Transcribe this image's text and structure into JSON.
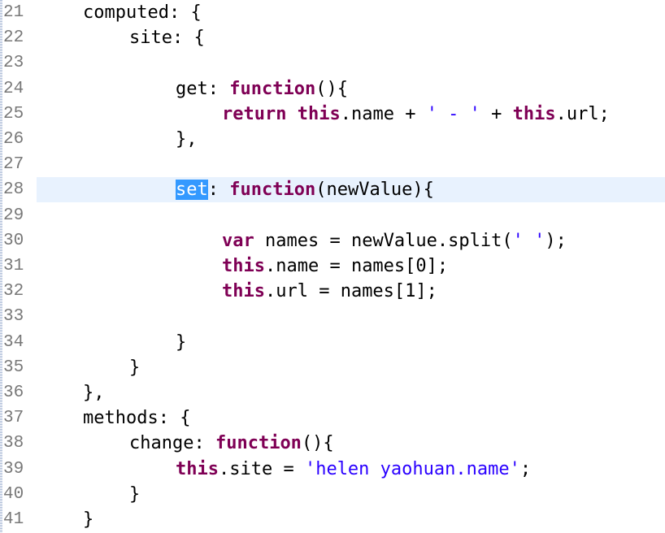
{
  "editor": {
    "lines": [
      {
        "num": "21",
        "indent": 1,
        "tokens": [
          {
            "t": "computed: {",
            "c": "plain"
          }
        ]
      },
      {
        "num": "22",
        "indent": 2,
        "tokens": [
          {
            "t": "site: {",
            "c": "plain"
          }
        ]
      },
      {
        "num": "23",
        "indent": 0,
        "tokens": []
      },
      {
        "num": "24",
        "indent": 3,
        "tokens": [
          {
            "t": "get: ",
            "c": "plain"
          },
          {
            "t": "function",
            "c": "kw"
          },
          {
            "t": "(){",
            "c": "plain"
          }
        ]
      },
      {
        "num": "25",
        "indent": 4,
        "tokens": [
          {
            "t": "return",
            "c": "kw"
          },
          {
            "t": " ",
            "c": "plain"
          },
          {
            "t": "this",
            "c": "kw"
          },
          {
            "t": ".name + ",
            "c": "plain"
          },
          {
            "t": "' - '",
            "c": "str"
          },
          {
            "t": " + ",
            "c": "plain"
          },
          {
            "t": "this",
            "c": "kw"
          },
          {
            "t": ".url;",
            "c": "plain"
          }
        ]
      },
      {
        "num": "26",
        "indent": 3,
        "tokens": [
          {
            "t": "},",
            "c": "plain"
          }
        ]
      },
      {
        "num": "27",
        "indent": 0,
        "tokens": []
      },
      {
        "num": "28",
        "indent": 3,
        "current": true,
        "tokens": [
          {
            "t": "set",
            "c": "sel"
          },
          {
            "t": ": ",
            "c": "plain"
          },
          {
            "t": "function",
            "c": "kw"
          },
          {
            "t": "(newValue){",
            "c": "plain"
          }
        ]
      },
      {
        "num": "29",
        "indent": 0,
        "tokens": []
      },
      {
        "num": "30",
        "indent": 4,
        "tokens": [
          {
            "t": "var",
            "c": "kw"
          },
          {
            "t": " names = newValue.split(",
            "c": "plain"
          },
          {
            "t": "' '",
            "c": "str"
          },
          {
            "t": ");",
            "c": "plain"
          }
        ]
      },
      {
        "num": "31",
        "indent": 4,
        "tokens": [
          {
            "t": "this",
            "c": "kw"
          },
          {
            "t": ".name = names[0];",
            "c": "plain"
          }
        ]
      },
      {
        "num": "32",
        "indent": 4,
        "tokens": [
          {
            "t": "this",
            "c": "kw"
          },
          {
            "t": ".url = names[1];",
            "c": "plain"
          }
        ]
      },
      {
        "num": "33",
        "indent": 0,
        "tokens": []
      },
      {
        "num": "34",
        "indent": 3,
        "tokens": [
          {
            "t": "}",
            "c": "plain"
          }
        ]
      },
      {
        "num": "35",
        "indent": 2,
        "tokens": [
          {
            "t": "}",
            "c": "plain"
          }
        ]
      },
      {
        "num": "36",
        "indent": 1,
        "tokens": [
          {
            "t": "},",
            "c": "plain"
          }
        ]
      },
      {
        "num": "37",
        "indent": 1,
        "tokens": [
          {
            "t": "methods: {",
            "c": "plain"
          }
        ]
      },
      {
        "num": "38",
        "indent": 2,
        "tokens": [
          {
            "t": "change: ",
            "c": "plain"
          },
          {
            "t": "function",
            "c": "kw"
          },
          {
            "t": "(){",
            "c": "plain"
          }
        ]
      },
      {
        "num": "39",
        "indent": 3,
        "tokens": [
          {
            "t": "this",
            "c": "kw"
          },
          {
            "t": ".site = ",
            "c": "plain"
          },
          {
            "t": "'helen yaohuan.name'",
            "c": "str"
          },
          {
            "t": ";",
            "c": "plain"
          }
        ]
      },
      {
        "num": "40",
        "indent": 2,
        "tokens": [
          {
            "t": "}",
            "c": "plain"
          }
        ]
      },
      {
        "num": "41",
        "indent": 1,
        "tokens": [
          {
            "t": "}",
            "c": "plain"
          }
        ]
      }
    ]
  },
  "colors": {
    "keyword": "#7f0055",
    "string": "#2a00ff",
    "line_number": "#787878",
    "current_line_bg": "#e8f2fe",
    "selection_bg": "#3399ff"
  }
}
